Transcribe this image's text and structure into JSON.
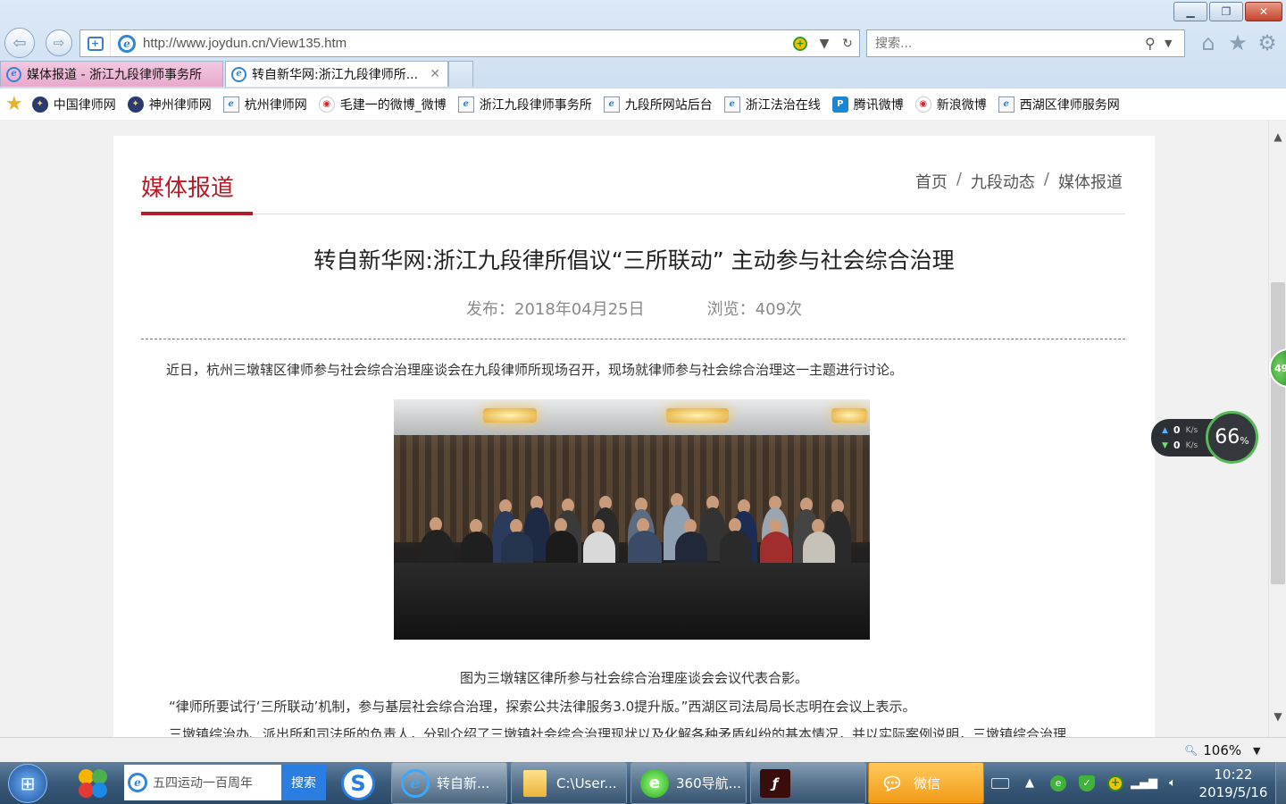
{
  "window": {
    "controls": {
      "minimize": "▁",
      "restore": "❐",
      "close": "✕"
    }
  },
  "address_bar": {
    "url": "http://www.joydun.cn/View135.htm"
  },
  "search": {
    "placeholder": "搜索..."
  },
  "tabs": [
    {
      "label": "媒体报道 - 浙江九段律师事务所",
      "active": false
    },
    {
      "label": "转自新华网:浙江九段律师所...",
      "active": true
    }
  ],
  "favorites": [
    {
      "label": "中国律师网",
      "icon": "court-emblem-icon"
    },
    {
      "label": "神州律师网",
      "icon": "court-emblem-icon"
    },
    {
      "label": "杭州律师网",
      "icon": "ie-page-icon"
    },
    {
      "label": "毛建一的微博_微博",
      "icon": "weibo-icon"
    },
    {
      "label": "浙江九段律师事务所",
      "icon": "ie-page-icon"
    },
    {
      "label": "九段所网站后台",
      "icon": "ie-page-icon"
    },
    {
      "label": "浙江法治在线",
      "icon": "ie-page-icon"
    },
    {
      "label": "腾讯微博",
      "icon": "tencent-weibo-icon"
    },
    {
      "label": "新浪微博",
      "icon": "weibo-icon"
    },
    {
      "label": "西湖区律师服务网",
      "icon": "ie-page-icon"
    }
  ],
  "page": {
    "section_title": "媒体报道",
    "breadcrumb": [
      "首页",
      "九段动态",
      "媒体报道"
    ],
    "breadcrumb_sep": "/",
    "article": {
      "title": "转自新华网:浙江九段律所倡议“三所联动” 主动参与社会综合治理",
      "published": "发布：2018年04月25日",
      "views": "浏览：409次",
      "paragraphs": [
        "近日，杭州三墩辖区律师参与社会综合治理座谈会在九段律师所现场召开，现场就律师参与社会综合治理这一主题进行讨论。",
        "“律师所要试行‘三所联动’机制，参与基层社会综合治理，探索公共法律服务3.0提升版。”西湖区司法局局长志明在会议上表示。",
        "三墩镇综治办、派出所和司法所的负责人，分别介绍了三墩镇社会综合治理现状以及化解各种矛盾纠纷的基本情况，并以实际案例说明，三墩镇综合治理"
      ],
      "image_caption": "图为三墩辖区律所参与社会综合治理座谈会会议代表合影。"
    }
  },
  "widgets": {
    "side_ball": "49",
    "net_up": "0",
    "net_down": "0",
    "net_unit": "K/s",
    "speed_value": "66",
    "speed_unit": "%"
  },
  "status_bar": {
    "zoom": "106%"
  },
  "taskbar": {
    "search_value": "五四运动一百周年",
    "search_button": "搜索",
    "tasks": [
      {
        "label": "转自新...",
        "icon": "ie-icon"
      },
      {
        "label": "C:\\User...",
        "icon": "folder-icon"
      },
      {
        "label": "360导航...",
        "icon": "360-browser-icon"
      },
      {
        "label": "",
        "icon": "flash-icon"
      },
      {
        "label": "微信",
        "icon": "wechat-icon"
      }
    ],
    "clock": {
      "time": "10:22",
      "date": "2019/5/16"
    }
  },
  "colors": {
    "accent_red": "#b41d28",
    "tab_active_pink": "#e7a9cc",
    "taskbar_blue": "#3a5a79",
    "wechat_orange": "#f29a17"
  }
}
